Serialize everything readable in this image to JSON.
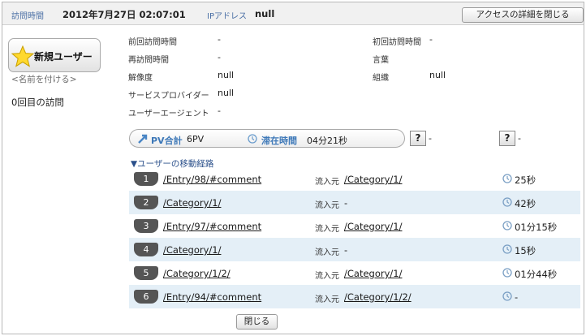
{
  "header": {
    "visit_time_label": "訪問時間",
    "visit_time": "2012年7月27日 02:07:01",
    "ip_label": "IPアドレス",
    "ip_value": "null",
    "close_access_label": "アクセスの詳細を閉じる"
  },
  "user": {
    "badge_label": "新規ユーザー",
    "name_link": "<名前を付ける>",
    "visit_count": "0回目の訪問"
  },
  "info": {
    "prev_visit_label": "前回訪問時間",
    "prev_visit_value": "-",
    "first_visit_label": "初回訪問時間",
    "first_visit_value": "-",
    "revisit_label": "再訪問時間",
    "revisit_value": "-",
    "language_label": "言葉",
    "language_value": "",
    "resolution_label": "解像度",
    "resolution_value": "null",
    "org_label": "組織",
    "org_value": "null",
    "provider_label": "サービスプロバイダー",
    "provider_value": "null",
    "agent_label": "ユーザーエージェント",
    "agent_value": "-"
  },
  "stats": {
    "pv_label": "PV合計",
    "pv_value": "6PV",
    "stay_label": "滞在時間",
    "stay_value": "04分21秒",
    "help1_label": "?",
    "help1_value": "-",
    "help2_label": "?",
    "help2_value": "-"
  },
  "path": {
    "title": "▼ユーザーの移動経路",
    "referrer_label": "流入元",
    "rows": [
      {
        "num": "1",
        "url": "/Entry/98/#comment",
        "ref": "/Category/1/",
        "dur": "25秒"
      },
      {
        "num": "2",
        "url": "/Category/1/",
        "ref": "-",
        "dur": "42秒"
      },
      {
        "num": "3",
        "url": "/Entry/97/#comment",
        "ref": "/Category/1/",
        "dur": "01分15秒"
      },
      {
        "num": "4",
        "url": "/Category/1/",
        "ref": "-",
        "dur": "15秒"
      },
      {
        "num": "5",
        "url": "/Category/1/2/",
        "ref": "/Category/1/",
        "dur": "01分44秒"
      },
      {
        "num": "6",
        "url": "/Entry/94/#comment",
        "ref": "/Category/1/2/",
        "dur": "-"
      }
    ]
  },
  "footer": {
    "close_label": "閉じる"
  }
}
